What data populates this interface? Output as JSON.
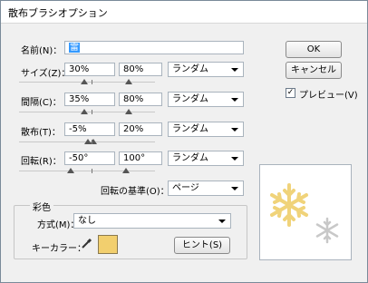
{
  "window": {
    "title": "散布ブラシオプション"
  },
  "name": {
    "label": "名前(N)：",
    "value": "雷"
  },
  "rows": [
    {
      "label": "サイズ(Z)：",
      "min": "30%",
      "max": "80%",
      "method": "ランダム"
    },
    {
      "label": "間隔(C)：",
      "min": "35%",
      "max": "80%",
      "method": "ランダム"
    },
    {
      "label": "散布(T)：",
      "min": "-5%",
      "max": "20%",
      "method": "ランダム"
    },
    {
      "label": "回転(R)：",
      "min": "-50°",
      "max": "100°",
      "method": "ランダム"
    }
  ],
  "rotation_basis": {
    "label": "回転の基準(O)：",
    "value": "ページ"
  },
  "colorization": {
    "group_label": "彩色",
    "method_label": "方式(M)：",
    "method_value": "なし",
    "key_color_label": "キーカラー：",
    "key_color": "#f2cf6e",
    "hint_button": "ヒント(S)"
  },
  "buttons": {
    "ok": "OK",
    "cancel": "キャンセル"
  },
  "preview": {
    "label": "プレビュー(V)",
    "checked": true,
    "check_mark": "✓"
  },
  "colors": {
    "snowflake_main": "#f0d37a",
    "snowflake_secondary": "#c8c8c8"
  }
}
